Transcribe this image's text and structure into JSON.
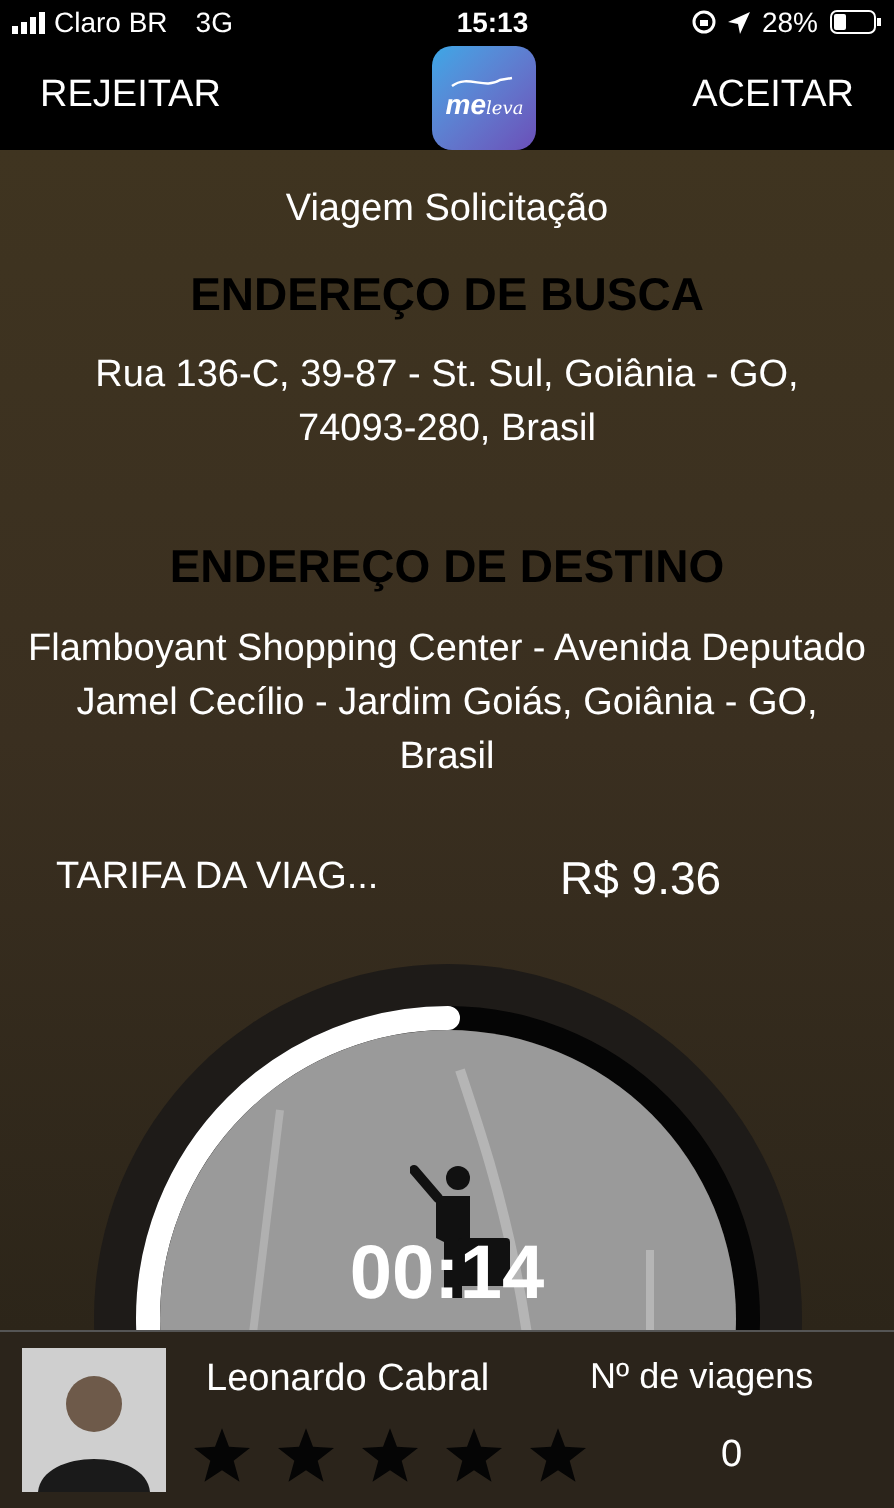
{
  "status_bar": {
    "carrier": "Claro BR",
    "network": "3G",
    "time": "15:13",
    "battery": "28%"
  },
  "nav": {
    "left": "REJEITAR",
    "right": "ACEITAR",
    "logo": {
      "primary": "me",
      "secondary": "leva"
    }
  },
  "title": "Viagem Solicitação",
  "pickup": {
    "heading": "ENDEREÇO DE BUSCA",
    "address": "Rua 136-C,  39-87 - St. Sul,  Goiânia - GO,  74093-280,  Brasil"
  },
  "destination": {
    "heading": "ENDEREÇO DE DESTINO",
    "address": "Flamboyant Shopping Center - Avenida Deputado Jamel Cecílio - Jardim Goiás, Goiânia - GO, Brasil"
  },
  "fare": {
    "label": "TARIFA DA VIAG...",
    "value": "R$ 9.36"
  },
  "timer": {
    "time": "00:14"
  },
  "driver": {
    "name": "Leonardo Cabral",
    "stars": 0,
    "trips_label": "Nº de viagens",
    "trips": "0"
  }
}
